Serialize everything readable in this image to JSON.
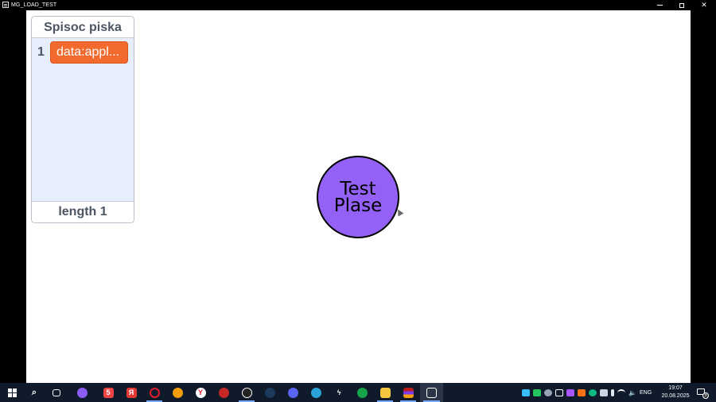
{
  "window": {
    "title": "MG_LOAD_TEST"
  },
  "panel": {
    "header": "Spisoc piska",
    "items": [
      {
        "index": "1",
        "label": "data:appl..."
      }
    ],
    "footer": "length 1"
  },
  "circle": {
    "line1": "Test",
    "line2": "Plase",
    "fill_color": "#9461f6"
  },
  "chip_color": "#f26a2d",
  "taskbar": {
    "language": "ENG",
    "time": "19:07",
    "date": "20.08.2025",
    "notification_count": "5",
    "pinned_icons": [
      "start-icon",
      "search-icon",
      "task-view-icon",
      "alice-icon",
      "html-icon",
      "yandex-browser-icon",
      "opera-icon",
      "fl-studio-icon",
      "yandex-icon",
      "record-icon",
      "obs-icon",
      "steam-icon",
      "discord-icon",
      "telegram-icon",
      "lightning-icon",
      "app-icon",
      "file-explorer-icon",
      "winrar-icon",
      "game-window-icon"
    ]
  }
}
